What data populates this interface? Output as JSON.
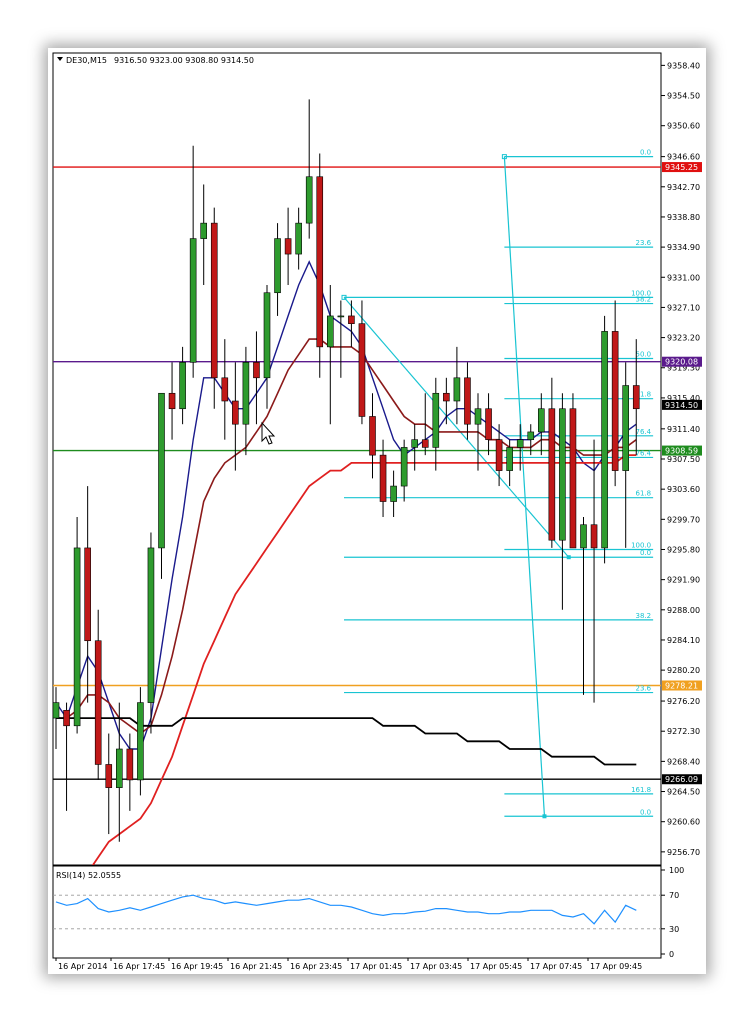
{
  "header": {
    "symbol": "DE30,M15",
    "ohlc": "9316.50 9323.00 9308.80 9314.50"
  },
  "rsi_header": "RSI(14) 52.0555",
  "colors": {
    "bull": "#2e9b2e",
    "bear": "#c01818",
    "fib": "#19c4d2",
    "ma_fast": "#1a1a8c",
    "ma_mid": "#8b1a1a",
    "ma_slow": "#e02020",
    "ma_long": "#000000",
    "rsi": "#1e90ff"
  },
  "chart_data": [
    {
      "type": "candlestick",
      "title": "DE30,M15",
      "ylim": [
        9255.0,
        9360.0
      ],
      "y_ticks": [
        "9358.40",
        "9354.50",
        "9350.60",
        "9346.60",
        "9342.70",
        "9338.80",
        "9334.90",
        "9331.00",
        "9327.10",
        "9323.20",
        "9319.30",
        "9315.40",
        "9311.40",
        "9307.50",
        "9303.60",
        "9299.70",
        "9295.80",
        "9291.90",
        "9288.00",
        "9284.10",
        "9280.20",
        "9276.20",
        "9272.30",
        "9268.40",
        "9264.50",
        "9260.60",
        "9256.70"
      ],
      "x_labels": [
        "16 Apr 2014",
        "16 Apr 17:45",
        "16 Apr 19:45",
        "16 Apr 21:45",
        "16 Apr 23:45",
        "17 Apr 01:45",
        "17 Apr 03:45",
        "17 Apr 05:45",
        "17 Apr 07:45",
        "17 Apr 09:45"
      ],
      "price_levels": [
        {
          "label": "9345.25",
          "value": 9345.25,
          "color": "#e01010"
        },
        {
          "label": "9320.08",
          "value": 9320.08,
          "color": "#5a1a8c"
        },
        {
          "label": "9308.59",
          "value": 9308.59,
          "color": "#1e8c1e"
        },
        {
          "label": "9278.21",
          "value": 9278.21,
          "color": "#f0a020"
        },
        {
          "label": "9266.09",
          "value": 9266.09,
          "color": "#000000"
        }
      ],
      "current_price": {
        "label": "9314.50",
        "value": 9314.5
      },
      "candles": [
        {
          "o": 9274,
          "h": 9278,
          "l": 9270,
          "c": 9276
        },
        {
          "o": 9275,
          "h": 9276,
          "l": 9262,
          "c": 9273
        },
        {
          "o": 9273,
          "h": 9300,
          "l": 9272,
          "c": 9296
        },
        {
          "o": 9296,
          "h": 9304,
          "l": 9276,
          "c": 9284
        },
        {
          "o": 9284,
          "h": 9288,
          "l": 9266,
          "c": 9268
        },
        {
          "o": 9268,
          "h": 9272,
          "l": 9259,
          "c": 9265
        },
        {
          "o": 9265,
          "h": 9276,
          "l": 9258,
          "c": 9270
        },
        {
          "o": 9270,
          "h": 9272,
          "l": 9262,
          "c": 9266
        },
        {
          "o": 9266,
          "h": 9278,
          "l": 9264,
          "c": 9276
        },
        {
          "o": 9276,
          "h": 9298,
          "l": 9272,
          "c": 9296
        },
        {
          "o": 9296,
          "h": 9316,
          "l": 9292,
          "c": 9316
        },
        {
          "o": 9316,
          "h": 9320,
          "l": 9310,
          "c": 9314
        },
        {
          "o": 9314,
          "h": 9322,
          "l": 9312,
          "c": 9320
        },
        {
          "o": 9320,
          "h": 9348,
          "l": 9318,
          "c": 9336
        },
        {
          "o": 9336,
          "h": 9343,
          "l": 9330,
          "c": 9338
        },
        {
          "o": 9338,
          "h": 9340,
          "l": 9314,
          "c": 9318
        },
        {
          "o": 9318,
          "h": 9323,
          "l": 9310,
          "c": 9315
        },
        {
          "o": 9315,
          "h": 9320,
          "l": 9306,
          "c": 9312
        },
        {
          "o": 9312,
          "h": 9322,
          "l": 9308,
          "c": 9320
        },
        {
          "o": 9320,
          "h": 9324,
          "l": 9312,
          "c": 9318
        },
        {
          "o": 9318,
          "h": 9330,
          "l": 9314,
          "c": 9329
        },
        {
          "o": 9329,
          "h": 9338,
          "l": 9326,
          "c": 9336
        },
        {
          "o": 9336,
          "h": 9340,
          "l": 9330,
          "c": 9334
        },
        {
          "o": 9334,
          "h": 9340,
          "l": 9332,
          "c": 9338
        },
        {
          "o": 9338,
          "h": 9354,
          "l": 9336,
          "c": 9344
        },
        {
          "o": 9344,
          "h": 9347,
          "l": 9318,
          "c": 9322
        },
        {
          "o": 9322,
          "h": 9330,
          "l": 9312,
          "c": 9326
        },
        {
          "o": 9326,
          "h": 9328,
          "l": 9318,
          "c": 9326
        },
        {
          "o": 9326,
          "h": 9328,
          "l": 9322,
          "c": 9325
        },
        {
          "o": 9325,
          "h": 9328,
          "l": 9312,
          "c": 9313
        },
        {
          "o": 9313,
          "h": 9316,
          "l": 9305,
          "c": 9308
        },
        {
          "o": 9308,
          "h": 9310,
          "l": 9300,
          "c": 9302
        },
        {
          "o": 9302,
          "h": 9306,
          "l": 9300,
          "c": 9304
        },
        {
          "o": 9304,
          "h": 9310,
          "l": 9302,
          "c": 9309
        },
        {
          "o": 9309,
          "h": 9312,
          "l": 9306,
          "c": 9310
        },
        {
          "o": 9310,
          "h": 9316,
          "l": 9308,
          "c": 9309
        },
        {
          "o": 9309,
          "h": 9318,
          "l": 9306,
          "c": 9316
        },
        {
          "o": 9316,
          "h": 9318,
          "l": 9312,
          "c": 9315
        },
        {
          "o": 9315,
          "h": 9322,
          "l": 9312,
          "c": 9318
        },
        {
          "o": 9318,
          "h": 9320,
          "l": 9310,
          "c": 9312
        },
        {
          "o": 9312,
          "h": 9316,
          "l": 9306,
          "c": 9314
        },
        {
          "o": 9314,
          "h": 9316,
          "l": 9308,
          "c": 9310
        },
        {
          "o": 9310,
          "h": 9312,
          "l": 9304,
          "c": 9306
        },
        {
          "o": 9306,
          "h": 9310,
          "l": 9304,
          "c": 9309
        },
        {
          "o": 9309,
          "h": 9312,
          "l": 9306,
          "c": 9310
        },
        {
          "o": 9310,
          "h": 9312,
          "l": 9308,
          "c": 9311
        },
        {
          "o": 9311,
          "h": 9316,
          "l": 9308,
          "c": 9314
        },
        {
          "o": 9314,
          "h": 9318,
          "l": 9296,
          "c": 9297
        },
        {
          "o": 9297,
          "h": 9316,
          "l": 9288,
          "c": 9314
        },
        {
          "o": 9314,
          "h": 9316,
          "l": 9296,
          "c": 9296
        },
        {
          "o": 9296,
          "h": 9300,
          "l": 9277,
          "c": 9299
        },
        {
          "o": 9299,
          "h": 9310,
          "l": 9276,
          "c": 9296
        },
        {
          "o": 9296,
          "h": 9326,
          "l": 9294,
          "c": 9324
        },
        {
          "o": 9324,
          "h": 9328,
          "l": 9304,
          "c": 9306
        },
        {
          "o": 9306,
          "h": 9320,
          "l": 9296,
          "c": 9317
        },
        {
          "o": 9317,
          "h": 9323,
          "l": 9308,
          "c": 9314
        }
      ],
      "moving_averages": [
        {
          "role": "fast",
          "values": [
            9276,
            9274,
            9278,
            9282,
            9280,
            9276,
            9272,
            9270,
            9270,
            9274,
            9283,
            9292,
            9300,
            9310,
            9318,
            9318,
            9316,
            9314,
            9314,
            9316,
            9318,
            9322,
            9326,
            9330,
            9333,
            9330,
            9326,
            9325,
            9324,
            9322,
            9318,
            9314,
            9310,
            9308,
            9309,
            9310,
            9311,
            9313,
            9314,
            9314,
            9313,
            9312,
            9311,
            9310,
            9310,
            9310,
            9311,
            9311,
            9310,
            9309,
            9307,
            9306,
            9308,
            9309,
            9311,
            9312
          ]
        },
        {
          "role": "mid",
          "values": [
            9274,
            9274,
            9275,
            9277,
            9277,
            9276,
            9274,
            9273,
            9272,
            9273,
            9277,
            9282,
            9288,
            9295,
            9302,
            9305,
            9307,
            9308,
            9309,
            9311,
            9313,
            9316,
            9319,
            9321,
            9323,
            9323,
            9322,
            9322,
            9322,
            9321,
            9319,
            9317,
            9315,
            9313,
            9312,
            9312,
            9311,
            9311,
            9311,
            9311,
            9311,
            9310,
            9310,
            9309,
            9309,
            9309,
            9310,
            9310,
            9309,
            9309,
            9308,
            9308,
            9308,
            9309,
            9309,
            9310
          ]
        },
        {
          "role": "slow",
          "values": [
            9248,
            9250,
            9252,
            9254,
            9256,
            9258,
            9259,
            9260,
            9261,
            9263,
            9266,
            9269,
            9273,
            9277,
            9281,
            9284,
            9287,
            9290,
            9292,
            9294,
            9296,
            9298,
            9300,
            9302,
            9304,
            9305,
            9306,
            9306,
            9307,
            9307,
            9307,
            9307,
            9307,
            9307,
            9307,
            9307,
            9307,
            9307,
            9307,
            9307,
            9307,
            9307,
            9307,
            9307,
            9307,
            9307,
            9307,
            9307,
            9307,
            9307,
            9307,
            9307,
            9307,
            9307,
            9308,
            9308
          ]
        },
        {
          "role": "long",
          "values": [
            9274,
            9274,
            9274,
            9274,
            9274,
            9274,
            9274,
            9274,
            9273,
            9273,
            9273,
            9273,
            9274,
            9274,
            9274,
            9274,
            9274,
            9274,
            9274,
            9274,
            9274,
            9274,
            9274,
            9274,
            9274,
            9274,
            9274,
            9274,
            9274,
            9274,
            9274,
            9273,
            9273,
            9273,
            9273,
            9272,
            9272,
            9272,
            9272,
            9271,
            9271,
            9271,
            9271,
            9270,
            9270,
            9270,
            9270,
            9269,
            9269,
            9269,
            9269,
            9269,
            9268,
            9268,
            9268,
            9268
          ]
        }
      ],
      "fibonacci": [
        {
          "anchor_high": 9346.6,
          "anchor_low": 9261.3,
          "levels": [
            {
              "label": "0.0",
              "value": 9346.6
            },
            {
              "label": "23.6",
              "value": 9334.9
            },
            {
              "label": "38.2",
              "value": 9327.6
            },
            {
              "label": "50.0",
              "value": 9320.5
            },
            {
              "label": "61.8",
              "value": 9315.3
            },
            {
              "label": "76.4",
              "value": 9310.5
            },
            {
              "label": "76.4",
              "value": 9307.7
            },
            {
              "label": "100.0",
              "value": 9295.8
            },
            {
              "label": "161.8",
              "value": 9264.2
            },
            {
              "label": "0.0",
              "value": 9261.3
            }
          ]
        },
        {
          "anchor_high": 9328.4,
          "anchor_low": 9294.8,
          "levels": [
            {
              "label": "100.0",
              "value": 9328.4
            },
            {
              "label": "61.8",
              "value": 9302.5
            },
            {
              "label": "38.2",
              "value": 9286.7
            },
            {
              "label": "23.6",
              "value": 9277.3
            },
            {
              "label": "0.0",
              "value": 9294.8
            }
          ]
        }
      ]
    },
    {
      "type": "line",
      "title": "RSI(14) 52.0555",
      "ylim": [
        0,
        100
      ],
      "y_ticks": [
        "100",
        "70",
        "30",
        "0"
      ],
      "series": [
        {
          "name": "RSI(14)",
          "values": [
            62,
            58,
            60,
            66,
            54,
            50,
            52,
            55,
            52,
            56,
            60,
            64,
            68,
            70,
            66,
            64,
            60,
            62,
            60,
            58,
            60,
            62,
            64,
            64,
            66,
            62,
            58,
            58,
            56,
            52,
            48,
            46,
            48,
            48,
            50,
            51,
            54,
            54,
            52,
            50,
            50,
            48,
            48,
            50,
            50,
            52,
            52,
            52,
            46,
            44,
            48,
            36,
            52,
            38,
            58,
            52
          ]
        }
      ],
      "levels": [
        70,
        30
      ]
    }
  ]
}
